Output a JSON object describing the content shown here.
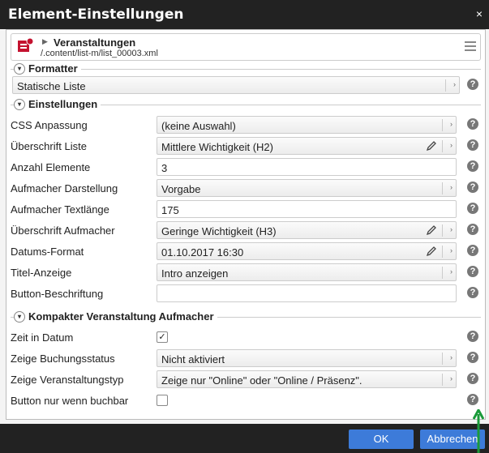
{
  "dialog": {
    "title": "Element-Einstellungen",
    "close": "×"
  },
  "resource": {
    "title": "Veranstaltungen",
    "path": "/.content/list-m/list_00003.xml"
  },
  "formatter": {
    "legend": "Formatter",
    "value": "Statische Liste"
  },
  "settings": {
    "legend": "Einstellungen",
    "rows": [
      {
        "label": "CSS Anpassung",
        "value": "(keine Auswahl)"
      },
      {
        "label": "Überschrift Liste",
        "value": "Mittlere Wichtigkeit (H2)"
      },
      {
        "label": "Anzahl Elemente",
        "value": "3"
      },
      {
        "label": "Aufmacher Darstellung",
        "value": "Vorgabe"
      },
      {
        "label": "Aufmacher Textlänge",
        "value": "175"
      },
      {
        "label": "Überschrift Aufmacher",
        "value": "Geringe Wichtigkeit (H3)"
      },
      {
        "label": "Datums-Format",
        "value": "01.10.2017 16:30"
      },
      {
        "label": "Titel-Anzeige",
        "value": "Intro anzeigen"
      },
      {
        "label": "Button-Beschriftung",
        "value": ""
      }
    ]
  },
  "compact": {
    "legend": "Kompakter Veranstaltung Aufmacher",
    "rows": [
      {
        "label": "Zeit in Datum",
        "checked": "✓"
      },
      {
        "label": "Zeige Buchungsstatus",
        "value": "Nicht aktiviert"
      },
      {
        "label": "Zeige Veranstaltungstyp",
        "value": "Zeige nur \"Online\" oder \"Online / Präsenz\"."
      },
      {
        "label": "Button nur wenn buchbar",
        "checked": ""
      }
    ]
  },
  "buttons": {
    "ok": "OK",
    "cancel": "Abbrechen"
  },
  "icons": {
    "help": "?",
    "toggle": "▾",
    "arrow": "›"
  }
}
